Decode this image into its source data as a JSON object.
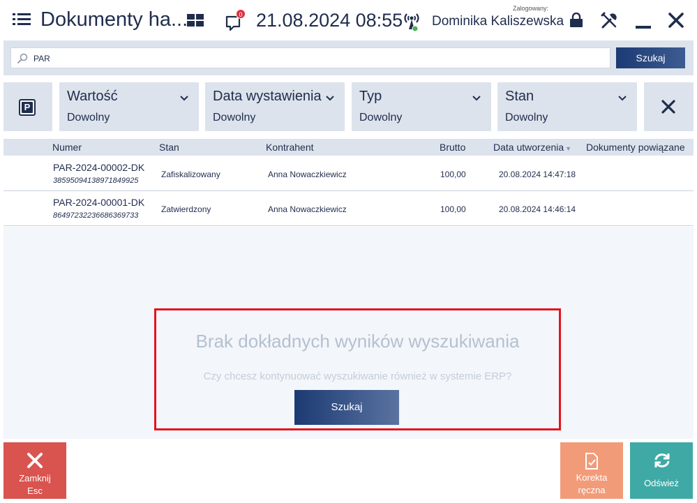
{
  "header": {
    "title": "Dokumenty ha...",
    "notification_count": "0",
    "datetime": "21.08.2024 08:55",
    "logged_label": "Zalogowany:",
    "user_name": "Dominika Kaliszewska"
  },
  "search": {
    "value": "PAR",
    "button_label": "Szukaj"
  },
  "filters": [
    {
      "label": "Wartość",
      "value": "Dowolny"
    },
    {
      "label": "Data wystawienia",
      "value": "Dowolny"
    },
    {
      "label": "Typ",
      "value": "Dowolny"
    },
    {
      "label": "Stan",
      "value": "Dowolny"
    }
  ],
  "table": {
    "columns": [
      "Numer",
      "Stan",
      "Kontrahent",
      "Brutto",
      "Data utworzenia",
      "Dokumenty powiązane"
    ],
    "rows": [
      {
        "numer": "PAR-2024-00002-DK",
        "kod": "38595094138971849925",
        "stan": "Zafiskalizowany",
        "kontrahent": "Anna Nowaczkiewicz",
        "brutto": "100,00",
        "data": "20.08.2024 14:47:18"
      },
      {
        "numer": "PAR-2024-00001-DK",
        "kod": "86497232236686369733",
        "stan": "Zatwierdzony",
        "kontrahent": "Anna Nowaczkiewicz",
        "brutto": "100,00",
        "data": "20.08.2024 14:46:14"
      }
    ]
  },
  "no_results": {
    "title": "Brak dokładnych wyników wyszukiwania",
    "subtitle": "Czy chcesz kontynuować wyszukiwanie również w systemie ERP?",
    "button_label": "Szukaj"
  },
  "footer": {
    "close_label_1": "Zamknij",
    "close_label_2": "Esc",
    "korekta_label_1": "Korekta",
    "korekta_label_2": "ręczna",
    "refresh_label": "Odśwież"
  },
  "colors": {
    "primary": "#1f2d4d",
    "panel": "#dde3ec",
    "close": "#d9534f",
    "korekta": "#f29b79",
    "refresh": "#3fa9a6",
    "highlight": "#e3141f"
  }
}
